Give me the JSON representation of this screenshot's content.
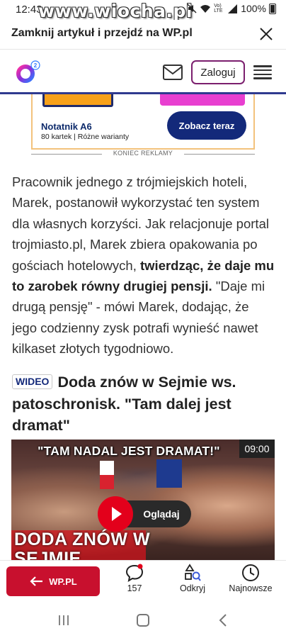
{
  "status_bar": {
    "time": "12:43",
    "watermark": "www.wiocha.pl",
    "signal_text": "Vo) LTE",
    "battery": "100%"
  },
  "close_bar": {
    "text": "Zamknij artykuł i przejdź na WP.pl",
    "close_icon": "close-icon"
  },
  "header": {
    "logo": "o2-logo",
    "mail_icon": "mail-icon",
    "login_label": "Zaloguj",
    "menu_icon": "hamburger-icon"
  },
  "ad": {
    "product_title": "Notatnik A6",
    "product_subtitle": "80 kartek | Różne warianty",
    "cta_label": "Zobacz teraz",
    "end_label": "KONIEC REKLAMY"
  },
  "article": {
    "text_before_bold": "Pracownik jednego z trójmiejskich hoteli, Marek, postanowił wykorzystać ten system dla własnych korzyści. Jak relacjonuje portal trojmiasto.pl, Marek zbiera opakowania po gościach hotelowych, ",
    "bold_text": "twierdząc, że daje mu to zarobek równy drugiej pensji.",
    "text_after_bold": " \"Daje mi drugą pensję\" - mówi Marek, dodając, że jego codzienny zysk potrafi wynieść nawet kilkaset złotych tygodniowo."
  },
  "video": {
    "badge": "WIDEO",
    "title": "Doda znów w Sejmie ws. patoschronisk. \"Tam dalej jest dramat\"",
    "thumbnail_headline": "\"TAM NADAL JEST DRAMAT!\"",
    "duration": "09:00",
    "watch_label": "Oglądaj",
    "caption": "DODA ZNÓW W SEJMIE"
  },
  "bottom_bar": {
    "back_label": "WP.PL",
    "comments_count": "157",
    "discover_label": "Odkryj",
    "newest_label": "Najnowsze",
    "accent": "#c8102e"
  },
  "colors": {
    "header_rule": "#2f3a8f",
    "login_border": "#7b1f6e",
    "ad_cta": "#13297a"
  }
}
